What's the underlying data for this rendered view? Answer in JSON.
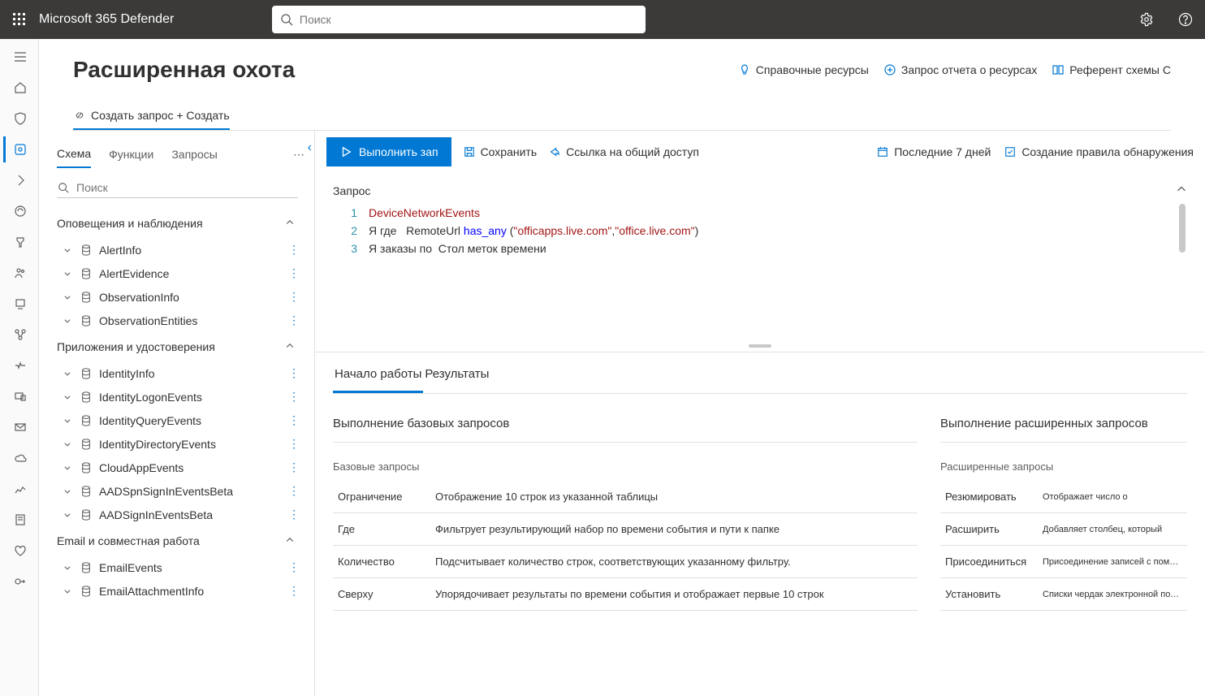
{
  "header": {
    "app_name": "Microsoft 365 Defender",
    "search_placeholder": "Поиск"
  },
  "page": {
    "title": "Расширенная охота",
    "links": [
      {
        "icon": "lightbulb",
        "label": "Справочные ресурсы"
      },
      {
        "icon": "resource",
        "label": "Запрос отчета о ресурсах"
      },
      {
        "icon": "book",
        "label": "Референт схемы С"
      }
    ],
    "crumb_icon": "link-icon",
    "crumb": "Создать запрос + Создать"
  },
  "schema_panel": {
    "tabs": [
      "Схема",
      "Функции",
      "Запросы"
    ],
    "active_tab": 0,
    "search_placeholder": "Поиск",
    "categories": [
      {
        "name": "Оповещения и наблюдения",
        "tables": [
          "AlertInfo",
          "AlertEvidence",
          "ObservationInfo",
          "ObservationEntities"
        ]
      },
      {
        "name": "Приложения и удостоверения",
        "tables": [
          "IdentityInfo",
          "IdentityLogonEvents",
          "IdentityQueryEvents",
          "IdentityDirectoryEvents",
          "CloudAppEvents",
          "AADSpnSignInEventsBeta",
          "AADSignInEventsBeta"
        ]
      },
      {
        "name": "Email и совместная работа",
        "tables": [
          "EmailEvents",
          "EmailAttachmentInfo"
        ]
      }
    ]
  },
  "toolbar": {
    "run": "Выполнить зап",
    "save": "Сохранить",
    "share": "Ссылка на общий доступ",
    "time": "Последние 7 дней",
    "rule": "Создание правила обнаружения"
  },
  "query": {
    "heading": "Запрос",
    "lines": [
      {
        "n": 1,
        "segments": [
          {
            "cls": "tok-table",
            "t": "DeviceNetworkEvents"
          }
        ]
      },
      {
        "n": 2,
        "segments": [
          {
            "cls": "tok-plain pre",
            "t": "Я где   "
          },
          {
            "cls": "tok-plain",
            "t": "RemoteUrl "
          },
          {
            "cls": "tok-oper",
            "t": "has_any"
          },
          {
            "cls": "tok-plain",
            "t": " ("
          },
          {
            "cls": "tok-str",
            "t": "\"officapps.live.com\""
          },
          {
            "cls": "tok-plain",
            "t": ","
          },
          {
            "cls": "tok-str",
            "t": "\"office.live.com\""
          },
          {
            "cls": "tok-plain",
            "t": ")"
          }
        ]
      },
      {
        "n": 3,
        "segments": [
          {
            "cls": "tok-plain pre",
            "t": "Я заказы по  "
          },
          {
            "cls": "tok-plain",
            "t": "Стол меток времени"
          }
        ]
      }
    ]
  },
  "results": {
    "tabs": [
      "Начало работы",
      "Результаты"
    ],
    "active_tab": 0,
    "left": {
      "title": "Выполнение базовых запросов",
      "subtitle": "Базовые запросы",
      "rows": [
        {
          "k": "Ограничение",
          "d": "Отображение 10 строк из указанной таблицы"
        },
        {
          "k": "Где",
          "d": "Фильтрует результирующий набор по времени события и пути к папке"
        },
        {
          "k": "Количество",
          "d": "Подсчитывает количество строк, соответствующих указанному фильтру."
        },
        {
          "k": "Сверху",
          "d": "Упорядочивает результаты по времени события и отображает первые 10 строк"
        }
      ]
    },
    "right": {
      "title": "Выполнение расширенных запросов",
      "subtitle": "Расширенные запросы",
      "rows": [
        {
          "k": "Резюмировать",
          "d": "Отображает число о"
        },
        {
          "k": "Расширить",
          "d": "Добавляет столбец, который"
        },
        {
          "k": "Присоединиться",
          "d": "Присоединение записей с помощью об"
        },
        {
          "k": "Установить",
          "d": "Списки чердак электронной почты"
        }
      ]
    }
  }
}
